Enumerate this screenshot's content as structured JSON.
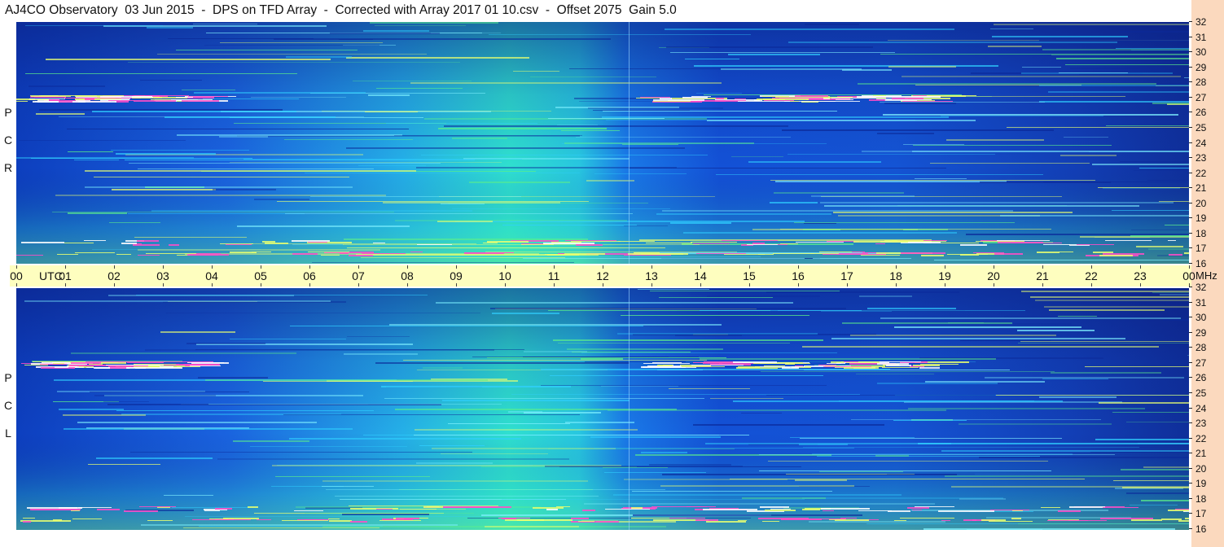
{
  "header": {
    "title": "AJ4CO Observatory  03 Jun 2015  -  DPS on TFD Array  -  Corrected with Array 2017 01 10.csv  -  Offset 2075  Gain 5.0"
  },
  "time_axis": {
    "utc_label": "UTC",
    "unit_label": "MHz",
    "ticks": [
      "00",
      "01",
      "02",
      "03",
      "04",
      "05",
      "06",
      "07",
      "08",
      "09",
      "10",
      "11",
      "12",
      "13",
      "14",
      "15",
      "16",
      "17",
      "18",
      "19",
      "20",
      "21",
      "22",
      "23",
      "00"
    ]
  },
  "panels": {
    "rcp": {
      "label_letters": [
        "R",
        "C",
        "P"
      ],
      "freq_ticks": [
        "32",
        "31",
        "30",
        "29",
        "28",
        "27",
        "26",
        "25",
        "24",
        "23",
        "22",
        "21",
        "20",
        "19",
        "18",
        "17",
        "16"
      ]
    },
    "lcp": {
      "label_letters": [
        "L",
        "C",
        "P"
      ],
      "freq_ticks": [
        "32",
        "31",
        "30",
        "29",
        "28",
        "27",
        "26",
        "25",
        "24",
        "23",
        "22",
        "21",
        "20",
        "19",
        "18",
        "17",
        "16"
      ]
    }
  },
  "colors": {
    "accent_axis": "#fefebf",
    "side_bar": "#fbd9be",
    "spectro_low": "#0a1a7a",
    "spectro_mid": "#1d6ff2",
    "spectro_high": "#2fe6c8"
  }
}
